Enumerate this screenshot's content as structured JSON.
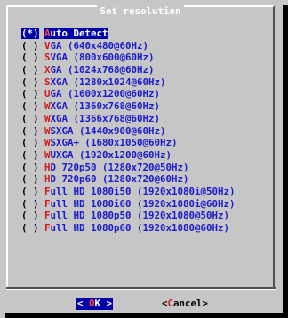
{
  "dialog": {
    "title": "Set resolution",
    "options": [
      {
        "mark": "(*)",
        "hotkey": "A",
        "rest": "uto Detect",
        "selected": true
      },
      {
        "mark": "( )",
        "hotkey": "V",
        "rest": "GA (640x480@60Hz)"
      },
      {
        "mark": "( )",
        "hotkey": "S",
        "rest": "VGA (800x600@60Hz)"
      },
      {
        "mark": "( )",
        "hotkey": "X",
        "rest": "GA (1024x768@60Hz)"
      },
      {
        "mark": "( )",
        "hotkey": "S",
        "rest": "XGA (1280x1024@60Hz)"
      },
      {
        "mark": "( )",
        "hotkey": "U",
        "rest": "GA (1600x1200@60Hz)"
      },
      {
        "mark": "( )",
        "hotkey": "W",
        "rest": "XGA (1360x768@60Hz)"
      },
      {
        "mark": "( )",
        "hotkey": "W",
        "rest": "XGA (1366x768@60Hz)"
      },
      {
        "mark": "( )",
        "hotkey": "W",
        "rest": "SXGA (1440x900@60Hz)"
      },
      {
        "mark": "( )",
        "hotkey": "W",
        "rest": "SXGA+ (1680x1050@60Hz)"
      },
      {
        "mark": "( )",
        "hotkey": "W",
        "rest": "UXGA (1920x1200@60Hz)"
      },
      {
        "mark": "( )",
        "hotkey": "H",
        "rest": "D 720p50 (1280x720@50Hz)"
      },
      {
        "mark": "( )",
        "hotkey": "H",
        "rest": "D 720p60 (1280x720@60Hz)"
      },
      {
        "mark": "( )",
        "hotkey": "F",
        "rest": "ull HD 1080i50 (1920x1080i@50Hz)"
      },
      {
        "mark": "( )",
        "hotkey": "F",
        "rest": "ull HD 1080i60 (1920x1080i@60Hz)"
      },
      {
        "mark": "( )",
        "hotkey": "F",
        "rest": "ull HD 1080p50 (1920x1080@50Hz)"
      },
      {
        "mark": "( )",
        "hotkey": "F",
        "rest": "ull HD 1080p60 (1920x1080@60Hz)"
      }
    ],
    "buttons": {
      "ok": {
        "left": "< ",
        "hotkey": "O",
        "rest": "K",
        "right": " >"
      },
      "cancel": {
        "left": "<",
        "hotkey": "C",
        "rest": "ancel",
        "right": ">"
      }
    }
  },
  "colors": {
    "background": "#c6c6c6",
    "selection": "#0000a8",
    "option_text": "#1a1acf",
    "hotkey": "#d81818"
  }
}
